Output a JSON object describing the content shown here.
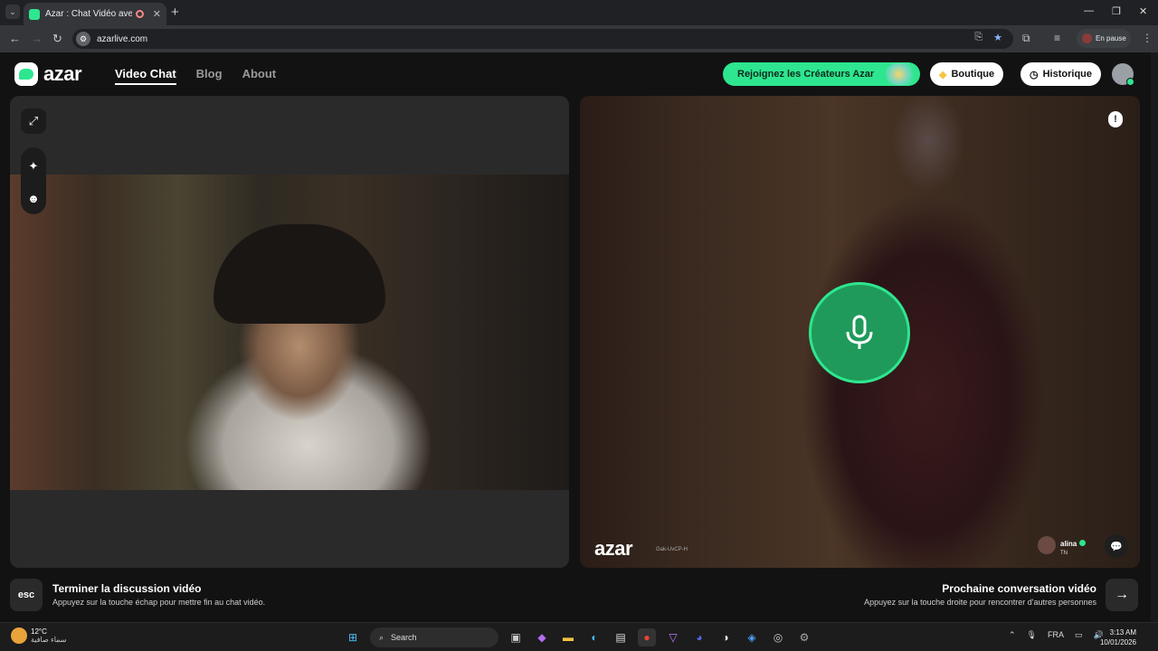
{
  "browser": {
    "tab_title": "Azar : Chat Vidéo avec de n",
    "url": "azarlive.com",
    "profile_status": "En pause"
  },
  "header": {
    "logo": "azar",
    "nav": [
      {
        "label": "Video Chat",
        "active": true
      },
      {
        "label": "Blog",
        "active": false
      },
      {
        "label": "About",
        "active": false
      }
    ],
    "creators_label": "Rejoignez les Créateurs Azar",
    "shop_label": "Boutique",
    "history_label": "Historique"
  },
  "remote": {
    "watermark": "azar",
    "watermark_code": "Gak-UvCP-H",
    "user_name": "alina",
    "user_country": "TN",
    "mic_color": "#2ee68f"
  },
  "footer": {
    "esc_key": "esc",
    "end_title": "Terminer la discussion vidéo",
    "end_sub": "Appuyez sur la touche échap pour mettre fin au chat vidéo.",
    "next_title": "Prochaine conversation vidéo",
    "next_sub": "Appuyez sur la touche droite pour rencontrer d'autres personnes"
  },
  "taskbar": {
    "temp": "12°C",
    "weather_desc": "سماء صافية",
    "search": "Search",
    "lang": "FRA",
    "time": "3:13 AM",
    "date": "10/01/2026"
  },
  "colors": {
    "accent": "#2ee68f",
    "background": "#121212"
  }
}
